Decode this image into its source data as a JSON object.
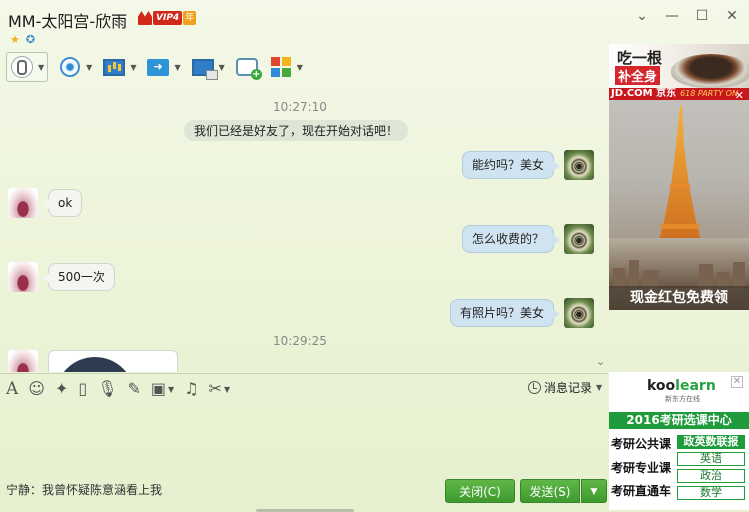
{
  "window": {
    "title": "MM-太阳宫-欣雨",
    "vip_label": "VIP4",
    "vip_year": "年",
    "controls": [
      "⌄",
      "—",
      "☐",
      "✕"
    ]
  },
  "toolbar": {
    "items": [
      "voice-call",
      "video-call",
      "screen-share",
      "file-transfer",
      "remote-assist",
      "new-discussion",
      "apps"
    ]
  },
  "chat": {
    "timestamps": [
      "10:27:10",
      "10:29:25"
    ],
    "system_message": "我们已经是好友了，现在开始对话吧！",
    "messages": [
      {
        "from": "me",
        "text": "能约吗？美女"
      },
      {
        "from": "her",
        "text": "ok"
      },
      {
        "from": "me",
        "text": "怎么收费的？"
      },
      {
        "from": "her",
        "text": "500一次"
      },
      {
        "from": "me",
        "text": "有照片吗？美女"
      }
    ]
  },
  "input_toolbar": {
    "history_label": "消息记录"
  },
  "footer": {
    "tip": "宁静：我曾怀疑陈意涵看上我",
    "close_label": "关闭(C)",
    "send_label": "发送(S)"
  },
  "ads": {
    "top_line1": "吃一根",
    "top_line2": "补全身",
    "jd_text": "JD.COM 京东",
    "jd_tag": "618 PARTY ON",
    "main_caption": "现金红包免费领",
    "kool_logo_pre": "koo",
    "kool_logo_post": "learn",
    "kool_sub": "新东方在线",
    "kool_banner": "2016考研选课中心",
    "kool_rows": [
      "考研公共课",
      "考研专业课",
      "考研直通车"
    ],
    "kool_tags": [
      "政英数联报",
      "英语",
      "政治",
      "数学"
    ]
  },
  "colors": {
    "accent_green": "#3f9a2d",
    "bubble_me": "#cfe3f0",
    "bubble_her": "#f4f4f0",
    "ad_red": "#d4262b"
  }
}
